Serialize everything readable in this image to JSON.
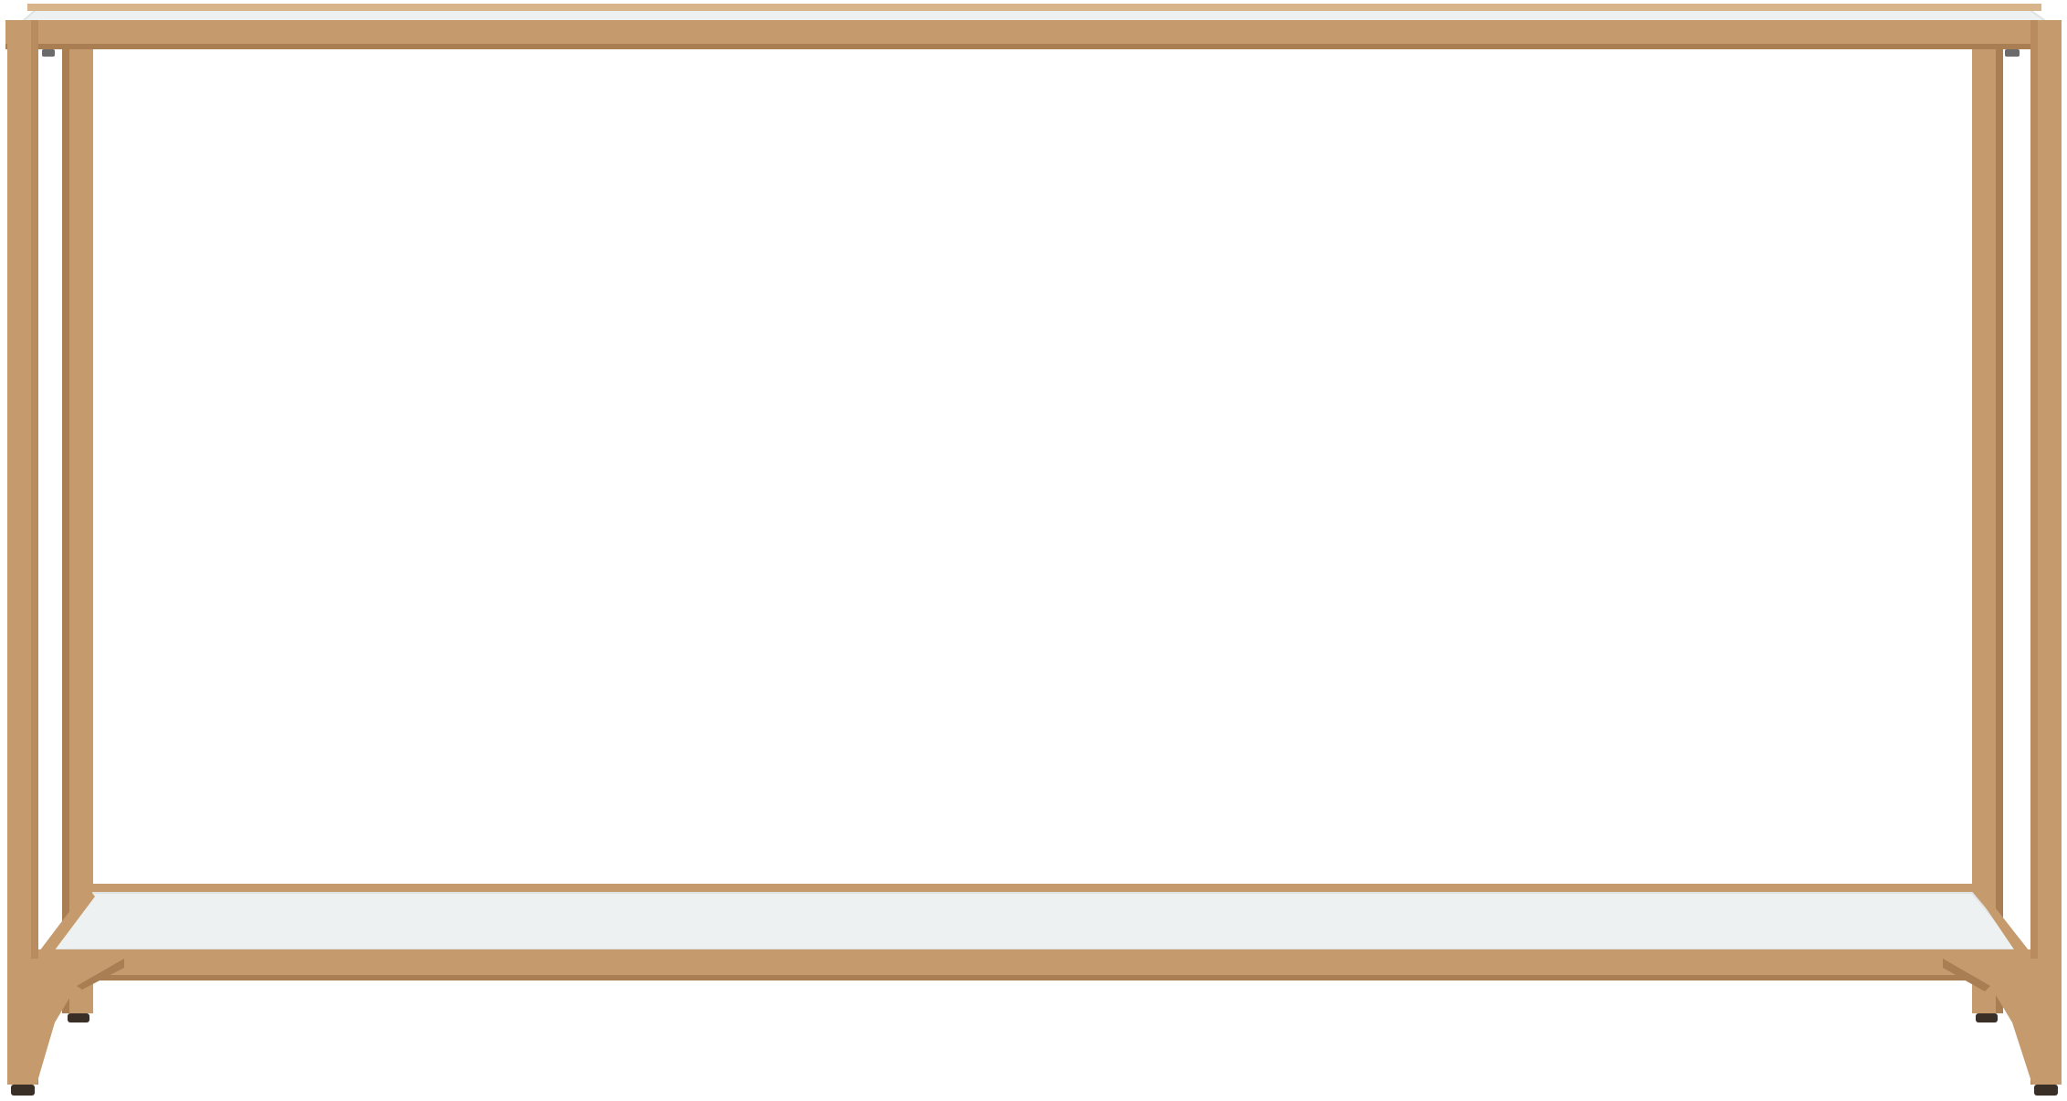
{
  "subject": "console-table",
  "colors": {
    "background": "#ffffff",
    "frame": "#c59a6c",
    "frame_dark": "#a97e52",
    "frame_light": "#d8b48a",
    "glass": "#eef1f1",
    "glass_edge": "#dfe3e3",
    "foot": "#3a2f26"
  }
}
